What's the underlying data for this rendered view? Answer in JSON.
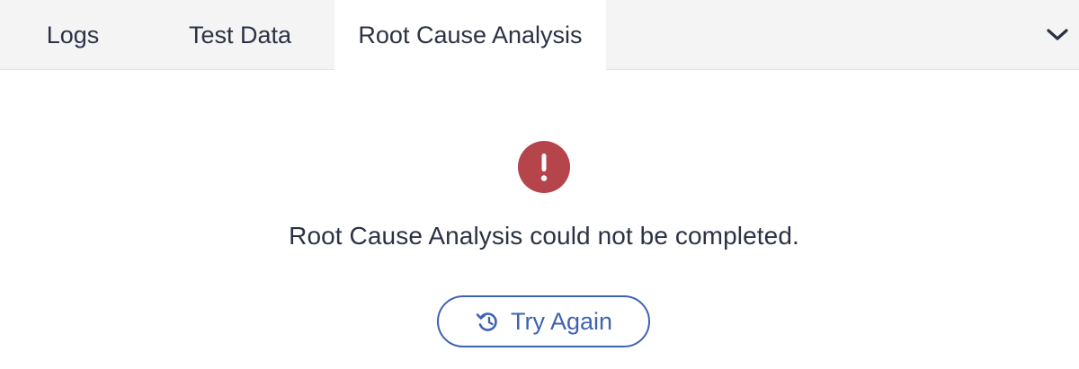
{
  "tabs": [
    {
      "label": "Logs",
      "active": false
    },
    {
      "label": "Test Data",
      "active": false
    },
    {
      "label": "Root Cause Analysis",
      "active": true
    }
  ],
  "collapse_toggle": {
    "icon": "chevron-down-icon"
  },
  "error_state": {
    "icon": "exclamation-circle-icon",
    "icon_color": "#b5444b",
    "message": "Root Cause Analysis could not be completed.",
    "retry_button": {
      "label": "Try Again",
      "icon": "retry-icon",
      "color": "#3e62b2"
    }
  }
}
